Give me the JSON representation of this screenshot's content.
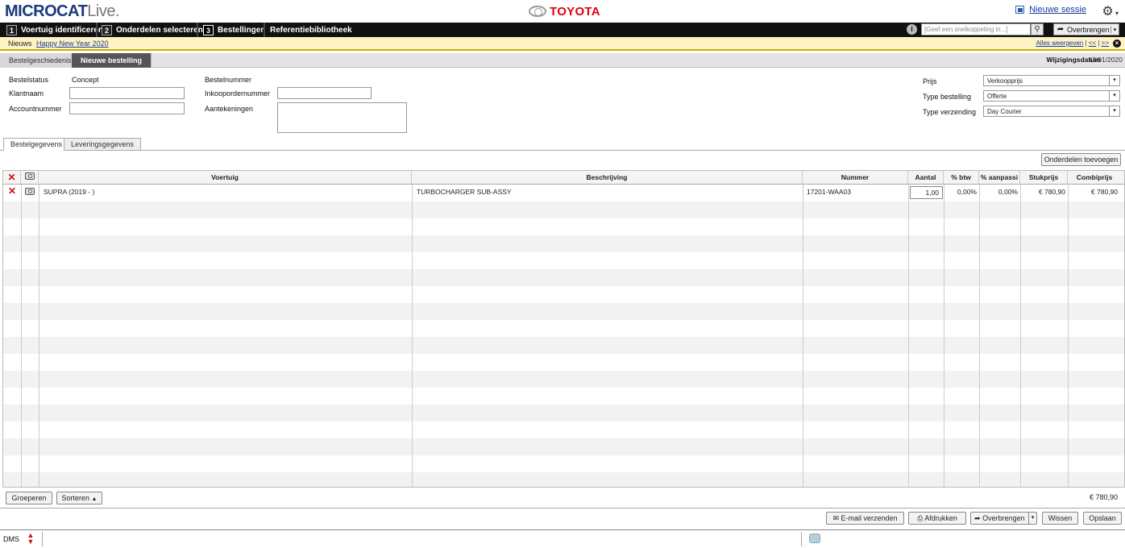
{
  "header": {
    "logo_main": "MICROCAT",
    "logo_live": "Live.",
    "brand": "TOYOTA",
    "new_session": "Nieuwe sessie"
  },
  "nav": {
    "steps": [
      {
        "num": "1",
        "label": "Voertuig identificeren"
      },
      {
        "num": "2",
        "label": "Onderdelen selecteren"
      },
      {
        "num": "3",
        "label": "Bestellingen"
      }
    ],
    "ref_lib": "Referentiebibliotheek",
    "quicklink_placeholder": "[Geef een snelkoppeling in...]",
    "transfer": "Overbrengen"
  },
  "news": {
    "label": "Nieuws",
    "item": "Happy New Year 2020",
    "show_all": "Alles weergeven",
    "prev": "<<",
    "next": ">>"
  },
  "subtabs": {
    "history": "Bestelgeschiedenis",
    "new_order": "Nieuwe bestelling",
    "modified_label": "Wijzigingsdatum",
    "modified_value": "13/01/2020"
  },
  "form": {
    "status_label": "Bestelstatus",
    "status_value": "Concept",
    "customer_label": "Klantnaam",
    "account_label": "Accountnummer",
    "order_no_label": "Bestelnummer",
    "po_label": "Inkoopordernummer",
    "notes_label": "Aantekeningen",
    "price_label": "Prijs",
    "price_value": "Verkoopprijs",
    "order_type_label": "Type bestelling",
    "order_type_value": "Offerte",
    "ship_label": "Type verzending",
    "ship_value": "Day Courier"
  },
  "detail_tabs": {
    "order": "Bestelgegevens",
    "delivery": "Leveringsgegevens",
    "add_parts": "Onderdelen toevoegen"
  },
  "table": {
    "columns": [
      "Voertuig",
      "Beschrijving",
      "Nummer",
      "Aantal",
      "% btw",
      "% aanpassi",
      "Stukprijs",
      "Combiprijs"
    ],
    "rows": [
      {
        "vehicle": "SUPRA (2019 - )",
        "description": "TURBOCHARGER SUB-ASSY",
        "number": "17201-WAA03",
        "qty": "1,00",
        "vat": "0,00%",
        "adj": "0,00%",
        "unit": "€ 780,90",
        "total": "€ 780,90"
      }
    ]
  },
  "footer": {
    "group": "Groeperen",
    "sort": "Sorteren",
    "total": "€ 780,90",
    "email": "E-mail verzenden",
    "print": "Afdrukken",
    "transfer": "Overbrengen",
    "clear": "Wissen",
    "save": "Opslaan",
    "dms": "DMS"
  },
  "colors": {
    "brand_red": "#e00012",
    "nav_bg": "#111111",
    "news_bg": "#fdf3c4",
    "delete_red": "#cc1010"
  }
}
